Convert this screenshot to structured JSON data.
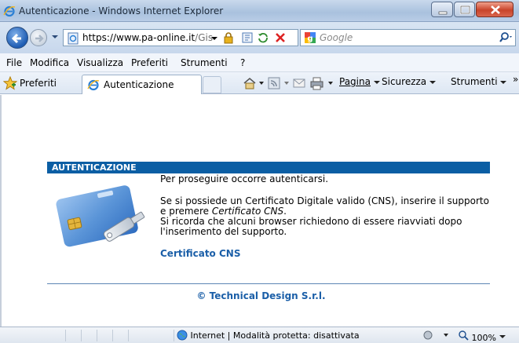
{
  "window": {
    "title": "Autenticazione - Windows Internet Explorer"
  },
  "address": {
    "url_scheme": "https://www.",
    "url_host": "pa-online.it",
    "url_rest": "/Gis"
  },
  "search": {
    "placeholder": "Google"
  },
  "menu": {
    "items": [
      {
        "label": "File"
      },
      {
        "label": "Modifica"
      },
      {
        "label": "Visualizza"
      },
      {
        "label": "Preferiti"
      },
      {
        "label": "Strumenti"
      },
      {
        "label": "?"
      }
    ]
  },
  "favbar": {
    "favorites_label": "Preferiti",
    "tab_label": "Autenticazione",
    "page_label": "Pagina",
    "security_label": "Sicurezza",
    "tools_label": "Strumenti",
    "overflow": "»"
  },
  "page": {
    "panel_title": "AUTENTICAZIONE",
    "intro": "Per proseguire occorre autenticarsi.",
    "line1": "Se si possiede un Certificato Digitale valido (CNS), inserire il supporto",
    "line2_prefix": "e premere ",
    "line2_em": "Certificato CNS",
    "line2_suffix": ".",
    "line3": "Si ricorda che alcuni browser richiedono di essere riavviati dopo",
    "line4": "l'inserimento del supporto.",
    "cns_link": "Certificato CNS",
    "copyright": "© Technical Design S.r.l."
  },
  "status": {
    "zone_text": "Internet | Modalità protetta: disattivata",
    "zoom": "100%"
  },
  "colors": {
    "panel_header": "#0b5ea4",
    "link": "#1b5fa8"
  }
}
